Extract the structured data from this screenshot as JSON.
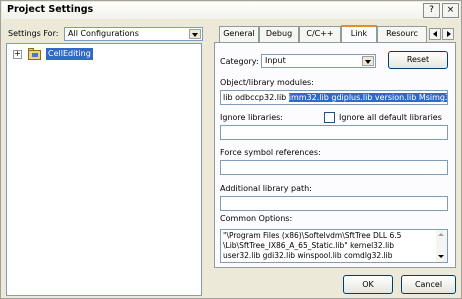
{
  "window": {
    "title": "Project Settings"
  },
  "left": {
    "settings_for_label": "Settings For:",
    "settings_for_value": "All Configurations",
    "tree": {
      "expander": "+",
      "item_label": "CellEditing"
    }
  },
  "tabs": [
    "General",
    "Debug",
    "C/C++",
    "Link",
    "Resourc"
  ],
  "link": {
    "category_label": "Category:",
    "category_value": "Input",
    "reset_label": "Reset",
    "modules_label": "Object/library modules:",
    "modules_prefix": "lib odbccp32.lib ",
    "modules_selected": "imm32.lib gdiplus.lib version.lib Msimg32.lib",
    "ignore_libraries_label": "Ignore libraries:",
    "ignore_all_default_label": "Ignore all default libraries",
    "ignore_all_default_checked": false,
    "force_symbol_label": "Force symbol references:",
    "additional_path_label": "Additional library path:",
    "common_options_label": "Common Options:",
    "common_options_lines": [
      "\"\\Program Files (x86)\\Softelvdm\\SftTree DLL 6.5",
      "\\Lib\\SftTree_IX86_A_65_Static.lib\" kernel32.lib",
      "user32.lib gdi32.lib winspool.lib comdlg32.lib"
    ]
  },
  "buttons": {
    "ok": "OK",
    "cancel": "Cancel"
  },
  "titlebar_buttons": {
    "help": "?",
    "close": "×"
  }
}
